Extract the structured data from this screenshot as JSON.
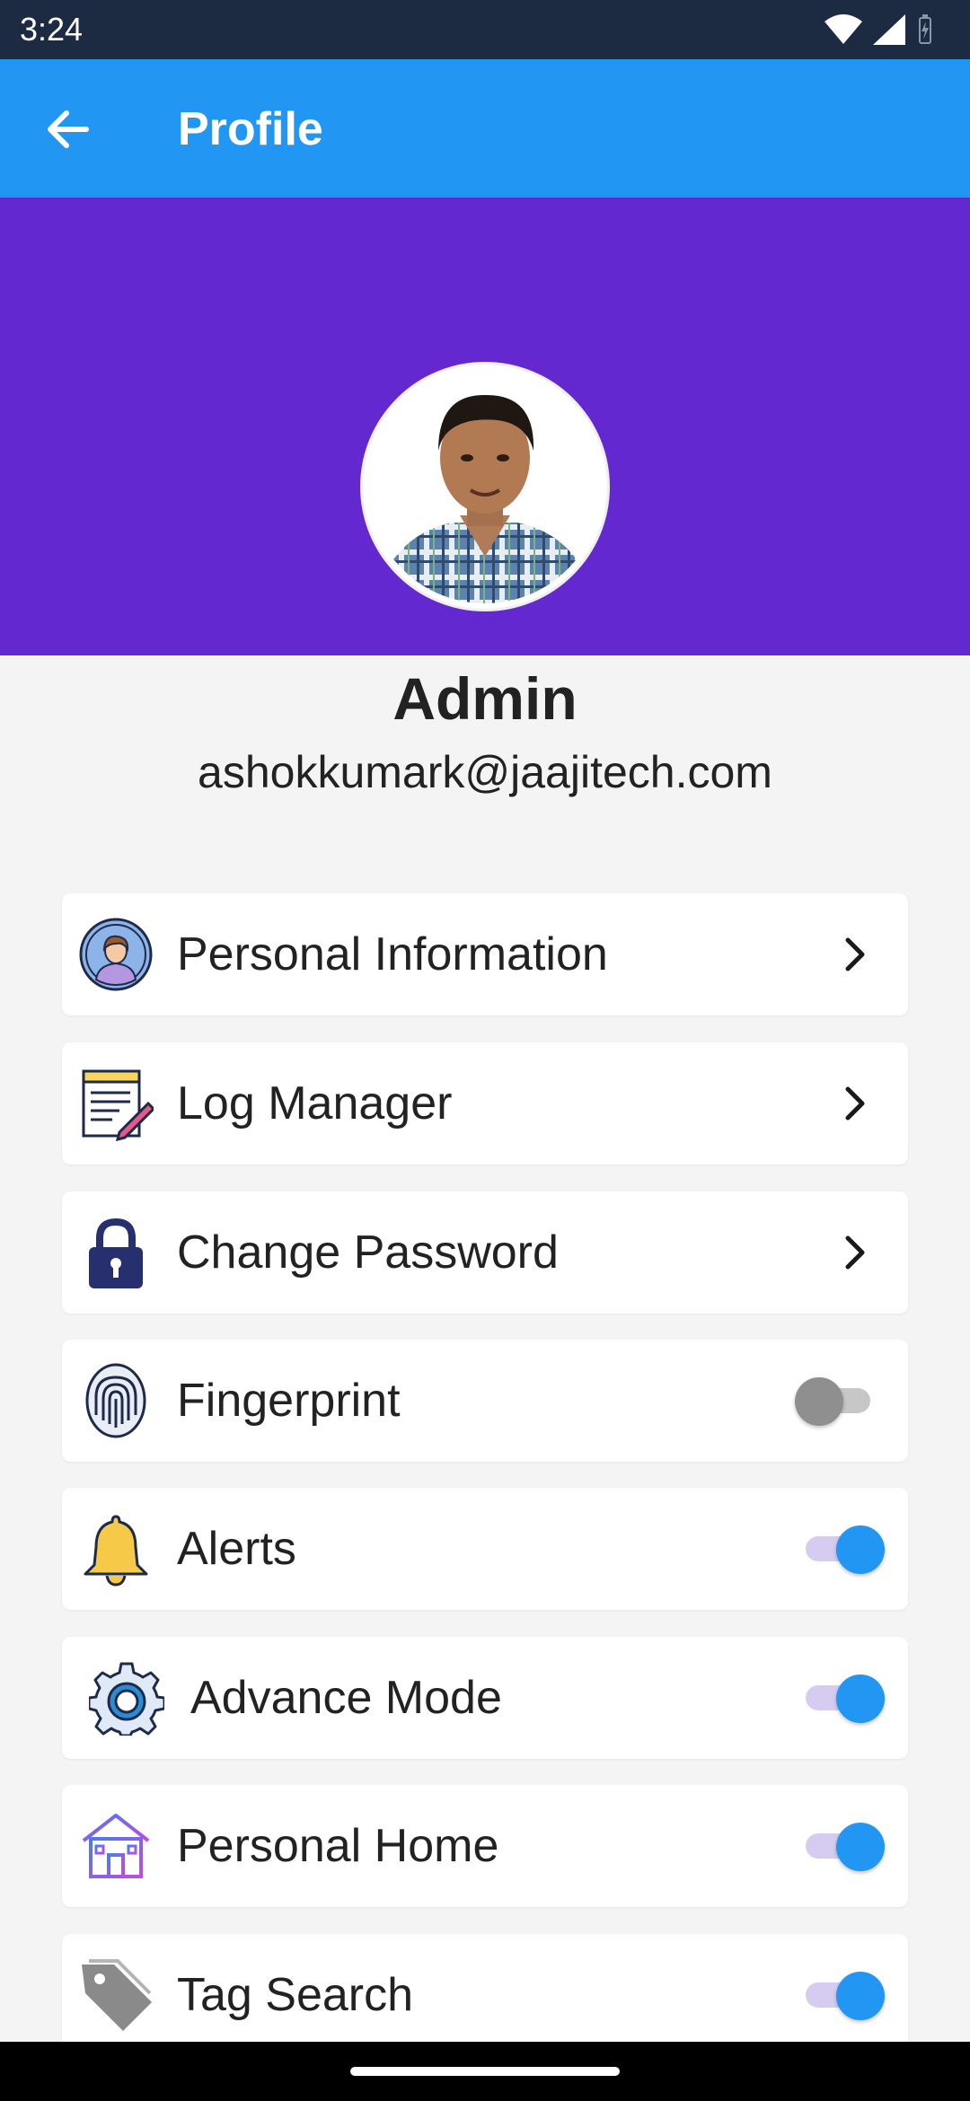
{
  "status_bar": {
    "time": "3:24",
    "icons": [
      "wifi-icon",
      "cellular-signal-icon",
      "battery-charging-icon"
    ]
  },
  "app_bar": {
    "title": "Profile",
    "back_icon": "arrow-back-icon"
  },
  "profile": {
    "name": "Admin",
    "email": "ashokkumark@jaajitech.com",
    "header_color": "#6428d0"
  },
  "menu": [
    {
      "label": "Personal Information",
      "icon": "user-avatar-icon",
      "control": "chevron"
    },
    {
      "label": "Log Manager",
      "icon": "notepad-pencil-icon",
      "control": "chevron"
    },
    {
      "label": "Change Password",
      "icon": "lock-icon",
      "control": "chevron"
    },
    {
      "label": "Fingerprint",
      "icon": "fingerprint-icon",
      "control": "toggle",
      "on": false
    },
    {
      "label": "Alerts",
      "icon": "bell-icon",
      "control": "toggle",
      "on": true
    },
    {
      "label": "Advance Mode",
      "icon": "gear-icon",
      "control": "toggle",
      "on": true
    },
    {
      "label": "Personal Home",
      "icon": "home-icon",
      "control": "toggle",
      "on": true
    },
    {
      "label": "Tag Search",
      "icon": "tag-icon",
      "control": "toggle",
      "on": true
    }
  ],
  "colors": {
    "app_bar": "#2196f3",
    "status_bar": "#1c2b42",
    "toggle_on": "#2196f3",
    "toggle_off": "#8f8f8f",
    "background": "#f4f4f4"
  }
}
